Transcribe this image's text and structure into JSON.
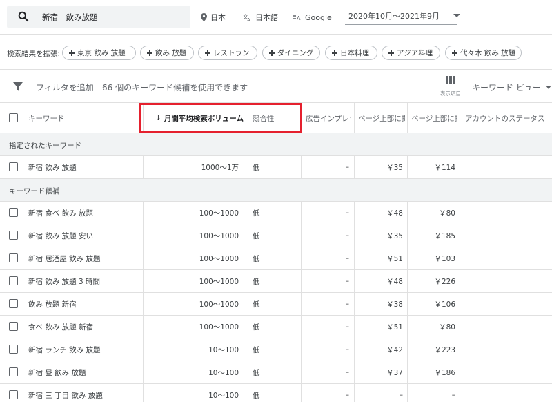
{
  "search": {
    "query": "新宿　飲み放題"
  },
  "filters": {
    "location": "日本",
    "language": "日本語",
    "network": "Google",
    "date_range": "2020年10月～2021年9月"
  },
  "expand": {
    "label": "検索結果を拡張:",
    "chips": [
      "東京 飲み 放題",
      "飲み 放題",
      "レストラン",
      "ダイニング",
      "日本料理",
      "アジア料理",
      "代々木 飲み 放題"
    ]
  },
  "toolbar": {
    "add_filter": "フィルタを追加",
    "count_text": "66 個のキーワード候補を使用できます",
    "columns_label": "表示項目",
    "view_label": "キーワード ビュー"
  },
  "table": {
    "headers": {
      "keyword": "キーワード",
      "volume": "月間平均検索ボリューム",
      "competition": "競合性",
      "impression": "広告インプレッ",
      "top_low": "ページ上部に掲",
      "top_high": "ページ上部に掲",
      "status": "アカウントのステータス"
    },
    "section_specified": "指定されたキーワード",
    "specified_rows": [
      {
        "keyword": "新宿 飲み 放題",
        "volume": "1000～1万",
        "competition": "低",
        "impression": "–",
        "low": "￥35",
        "high": "￥114"
      }
    ],
    "section_ideas": "キーワード候補",
    "idea_rows": [
      {
        "keyword": "新宿 食べ 飲み 放題",
        "volume": "100～1000",
        "competition": "低",
        "impression": "–",
        "low": "￥48",
        "high": "￥80"
      },
      {
        "keyword": "新宿 飲み 放題 安い",
        "volume": "100～1000",
        "competition": "低",
        "impression": "–",
        "low": "￥35",
        "high": "￥185"
      },
      {
        "keyword": "新宿 居酒屋 飲み 放題",
        "volume": "100～1000",
        "competition": "低",
        "impression": "–",
        "low": "￥51",
        "high": "￥103"
      },
      {
        "keyword": "新宿 飲み 放題 3 時間",
        "volume": "100～1000",
        "competition": "低",
        "impression": "–",
        "low": "￥48",
        "high": "￥226"
      },
      {
        "keyword": "飲み 放題 新宿",
        "volume": "100～1000",
        "competition": "低",
        "impression": "–",
        "low": "￥38",
        "high": "￥106"
      },
      {
        "keyword": "食べ 飲み 放題 新宿",
        "volume": "100～1000",
        "competition": "低",
        "impression": "–",
        "low": "￥51",
        "high": "￥80"
      },
      {
        "keyword": "新宿 ランチ 飲み 放題",
        "volume": "10～100",
        "competition": "低",
        "impression": "–",
        "low": "￥42",
        "high": "￥223"
      },
      {
        "keyword": "新宿 昼 飲み 放題",
        "volume": "10～100",
        "competition": "低",
        "impression": "–",
        "low": "￥37",
        "high": "￥186"
      },
      {
        "keyword": "新宿 三 丁目 飲み 放題",
        "volume": "10～100",
        "competition": "低",
        "impression": "–",
        "low": "–",
        "high": "–"
      }
    ]
  },
  "colors": {
    "highlight": "#e5202e",
    "section_bg": "#f1f3f4",
    "border": "#e0e0e0"
  }
}
